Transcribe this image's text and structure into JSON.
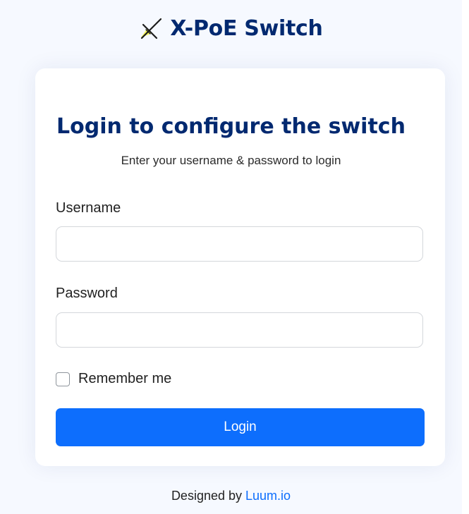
{
  "brand": {
    "icon": "switch-logo-icon",
    "name": "X-PoE Switch"
  },
  "login_card": {
    "title": "Login to configure the switch",
    "subtitle": "Enter your username & password to login",
    "username": {
      "label": "Username",
      "value": ""
    },
    "password": {
      "label": "Password",
      "value": ""
    },
    "remember_me": {
      "label": "Remember me",
      "checked": false
    },
    "login_button_label": "Login"
  },
  "footer": {
    "prefix": "Designed by ",
    "link_text": "Luum.io"
  },
  "colors": {
    "page_background": "#f6f9ff",
    "brand_navy": "#012970",
    "primary_blue": "#0d6efd"
  }
}
